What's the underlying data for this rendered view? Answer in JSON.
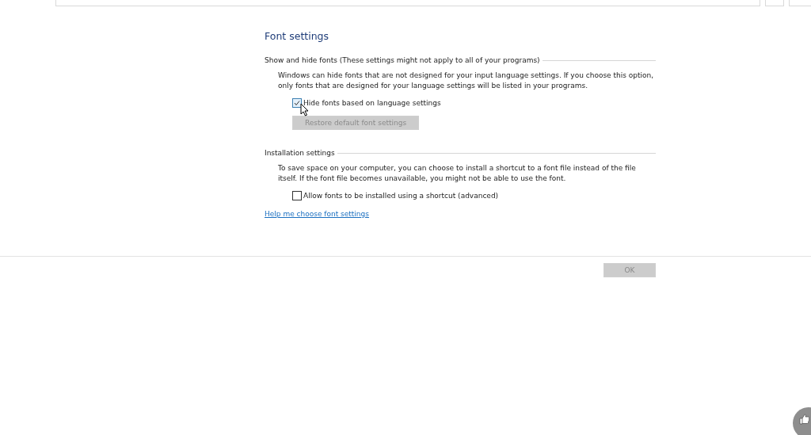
{
  "title": "Font settings",
  "sections": [
    {
      "heading": "Show and hide fonts (These settings might not apply to all of your programs)",
      "description": "Windows can hide fonts that are not designed for your input language settings. If you choose this option, only fonts that are designed for your language settings will be listed in your programs.",
      "checkbox": {
        "label": "Hide fonts based on language settings",
        "checked": true
      },
      "button": {
        "label": "Restore default font settings",
        "disabled": true
      }
    },
    {
      "heading": "Installation settings",
      "description": "To save space on your computer, you can choose to install a shortcut to a font file instead of the file itself. If the font file becomes unavailable, you might not be able to use the font.",
      "checkbox": {
        "label": "Allow fonts to be installed using a shortcut (advanced)",
        "checked": false
      }
    }
  ],
  "help_link": "Help me choose font settings",
  "footer_button": {
    "label": "OK",
    "disabled": true
  }
}
